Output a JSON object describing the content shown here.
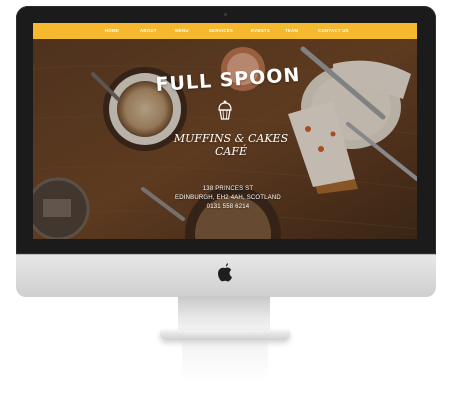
{
  "nav": {
    "items": [
      "HOME",
      "ABOUT",
      "MENU",
      "SERVICES",
      "EVENTS",
      "TEAM",
      "CONTACT US"
    ],
    "bar_color": "#f5b82e"
  },
  "hero": {
    "title": "FULL SPOON",
    "tagline": "MUFFINS & CAKES CAFÉ",
    "address_line1": "138 PRINCES ST",
    "address_line2": "EDINBURGH, EH2 4AH, SCOTLAND",
    "phone": "0131 558 6214"
  },
  "icons": {
    "logo_mark": "cupcake-icon",
    "brand": "apple-logo-icon"
  }
}
